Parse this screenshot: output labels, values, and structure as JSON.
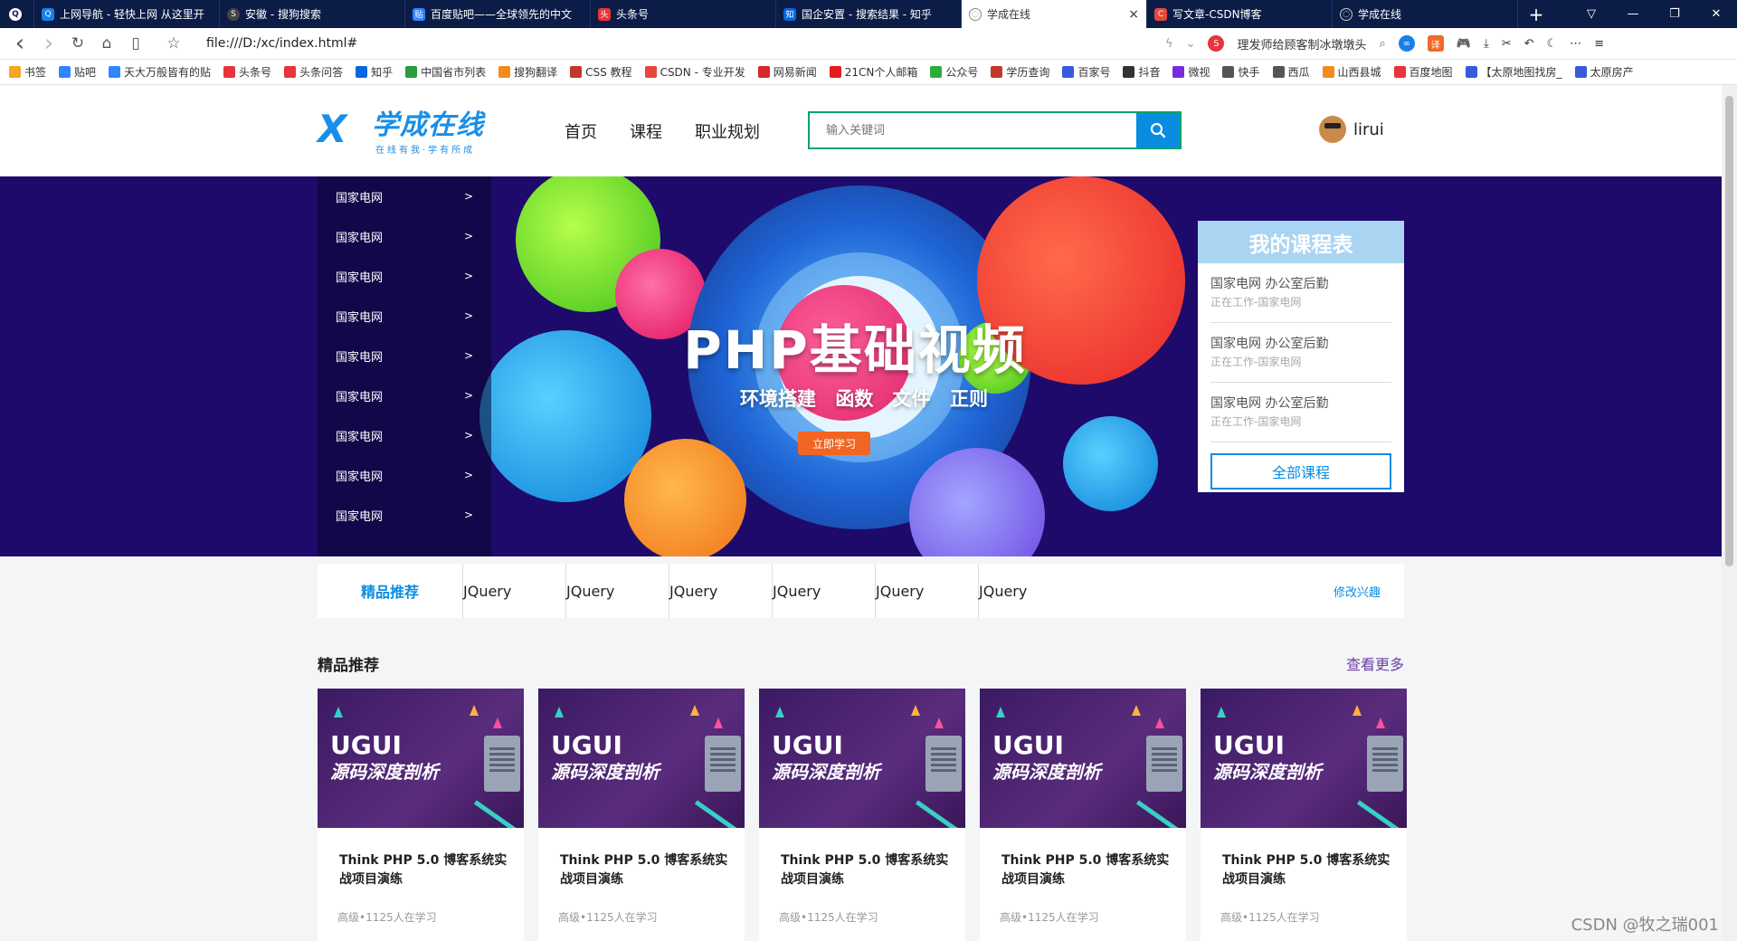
{
  "browser": {
    "tabs": [
      {
        "label": "",
        "color": "#ffffff"
      },
      {
        "label": "上网导航 - 轻快上网 从这里开",
        "color": "#1a7fe8"
      },
      {
        "label": "安徽 - 搜狗搜索",
        "color": "#444444"
      },
      {
        "label": "百度贴吧——全球领先的中文",
        "color": "#3385ff"
      },
      {
        "label": "头条号",
        "color": "#e8343c"
      },
      {
        "label": "国企安置 - 搜索结果 - 知乎",
        "color": "#0a66e0"
      },
      {
        "label": "学成在线",
        "color": "#888888",
        "active": true
      },
      {
        "label": "写文章-CSDN博客",
        "color": "#e5483b"
      },
      {
        "label": "学成在线",
        "color": "#888888"
      }
    ],
    "tab_close": "×",
    "new_tab": "+",
    "window_controls": [
      "▽",
      "—",
      "❐",
      "✕"
    ],
    "nav": {
      "back": "‹",
      "forward": "›",
      "reload": "↻",
      "home": "⌂",
      "reader": "▯",
      "star": "☆"
    },
    "url": "file:///D:/xc/index.html#",
    "search_hint": "理发师给顾客制冰墩墩头",
    "bookmarks": [
      {
        "label": "书签",
        "color": "#f5a623"
      },
      {
        "label": "贴吧",
        "color": "#3385ff"
      },
      {
        "label": "天大万般皆有的贴",
        "color": "#3385ff"
      },
      {
        "label": "头条号",
        "color": "#e8343c"
      },
      {
        "label": "头条问答",
        "color": "#e8343c"
      },
      {
        "label": "知乎",
        "color": "#0a66e0"
      },
      {
        "label": "中国省市列表",
        "color": "#2b9b3c"
      },
      {
        "label": "搜狗翻译",
        "color": "#f08c1e"
      },
      {
        "label": "CSS 教程",
        "color": "#c0392b"
      },
      {
        "label": "CSDN - 专业开发",
        "color": "#e5483b"
      },
      {
        "label": "网易新闻",
        "color": "#d6282b"
      },
      {
        "label": "21CN个人邮箱",
        "color": "#e31d1d"
      },
      {
        "label": "公众号",
        "color": "#2bad3c"
      },
      {
        "label": "学历查询",
        "color": "#c0392b"
      },
      {
        "label": "百家号",
        "color": "#3a5bd9"
      },
      {
        "label": "抖音",
        "color": "#333333"
      },
      {
        "label": "微视",
        "color": "#7a2bd9"
      },
      {
        "label": "快手",
        "color": "#555555"
      },
      {
        "label": "西瓜",
        "color": "#555555"
      },
      {
        "label": "山西县城",
        "color": "#f08c1e"
      },
      {
        "label": "百度地图",
        "color": "#e8343c"
      },
      {
        "label": "【太原地图找房_",
        "color": "#3a5bd9"
      },
      {
        "label": "太原房产",
        "color": "#3a5bd9"
      }
    ]
  },
  "header": {
    "logo_mark": "X",
    "logo_text": "学成在线",
    "logo_slogan": "在线有我·学有所成",
    "nav": [
      "首页",
      "课程",
      "职业规划"
    ],
    "search_placeholder": "输入关键词",
    "user_name": "lirui"
  },
  "banner": {
    "title": "PHP基础视频",
    "subtitle": "环境搭建  函数  文件  正则",
    "button": "立即学习",
    "side_menu": [
      {
        "label": "国家电网",
        "arrow": ">"
      },
      {
        "label": "国家电网",
        "arrow": ">"
      },
      {
        "label": "国家电网",
        "arrow": ">"
      },
      {
        "label": "国家电网",
        "arrow": ">"
      },
      {
        "label": "国家电网",
        "arrow": ">"
      },
      {
        "label": "国家电网",
        "arrow": ">"
      },
      {
        "label": "国家电网",
        "arrow": ">"
      },
      {
        "label": "国家电网",
        "arrow": ">"
      },
      {
        "label": "国家电网",
        "arrow": ">"
      }
    ],
    "course_table": {
      "title": "我的课程表",
      "items": [
        {
          "title": "国家电网 办公室后勤",
          "sub": "正在工作-国家电网"
        },
        {
          "title": "国家电网 办公室后勤",
          "sub": "正在工作-国家电网"
        },
        {
          "title": "国家电网 办公室后勤",
          "sub": "正在工作-国家电网"
        }
      ],
      "button": "全部课程"
    }
  },
  "subnav": {
    "first": "精品推荐",
    "items": [
      "JQuery",
      "JQuery",
      "JQuery",
      "JQuery",
      "JQuery",
      "JQuery"
    ],
    "edit": "修改兴趣"
  },
  "section": {
    "title": "精品推荐",
    "more": "查看更多",
    "cards": [
      {
        "img_big": "UGUI",
        "img_sub": "源码深度剖析",
        "title": "Think PHP 5.0 博客系统实战项目演练",
        "meta": "高级•1125人在学习"
      },
      {
        "img_big": "UGUI",
        "img_sub": "源码深度剖析",
        "title": "Think PHP 5.0 博客系统实战项目演练",
        "meta": "高级•1125人在学习"
      },
      {
        "img_big": "UGUI",
        "img_sub": "源码深度剖析",
        "title": "Think PHP 5.0 博客系统实战项目演练",
        "meta": "高级•1125人在学习"
      },
      {
        "img_big": "UGUI",
        "img_sub": "源码深度剖析",
        "title": "Think PHP 5.0 博客系统实战项目演练",
        "meta": "高级•1125人在学习"
      },
      {
        "img_big": "UGUI",
        "img_sub": "源码深度剖析",
        "title": "Think PHP 5.0 博客系统实战项目演练",
        "meta": "高级•1125人在学习"
      }
    ]
  },
  "watermark": "CSDN @牧之瑞001",
  "colors": {
    "accent": "#0a8ce0",
    "search_border": "#05a36c",
    "banner_bg": "#1d0a6b",
    "more_link": "#6d3fa4"
  }
}
